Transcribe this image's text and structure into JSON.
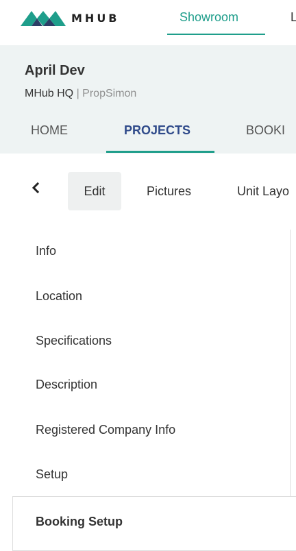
{
  "brand": {
    "name": "MHUB",
    "colors": {
      "accent": "#1f9e8b",
      "logo_teal": "#1f9e8b",
      "logo_navy": "#2c3e66",
      "active_tab_text": "#2f4a8a",
      "header_bg": "#eef3f3"
    }
  },
  "topnav": {
    "items": [
      {
        "label": "Showroom",
        "active": true
      },
      {
        "label": "L",
        "active": false
      }
    ]
  },
  "project": {
    "name": "April Dev",
    "company": "MHub HQ",
    "separator": " | ",
    "user": "PropSimon"
  },
  "section_tabs": [
    {
      "label": "HOME",
      "active": false
    },
    {
      "label": "PROJECTS",
      "active": true
    },
    {
      "label": "BOOKI",
      "active": false
    }
  ],
  "subtabs": {
    "back_icon": "chevron-left-icon",
    "items": [
      {
        "label": "Edit",
        "active": true
      },
      {
        "label": "Pictures",
        "active": false
      },
      {
        "label": "Unit Layo",
        "active": false
      }
    ]
  },
  "left_menu": {
    "items": [
      {
        "label": "Info"
      },
      {
        "label": "Location"
      },
      {
        "label": "Specifications"
      },
      {
        "label": "Description"
      },
      {
        "label": "Registered Company Info"
      },
      {
        "label": "Setup"
      }
    ],
    "active_item": {
      "label": "Booking Setup"
    }
  }
}
